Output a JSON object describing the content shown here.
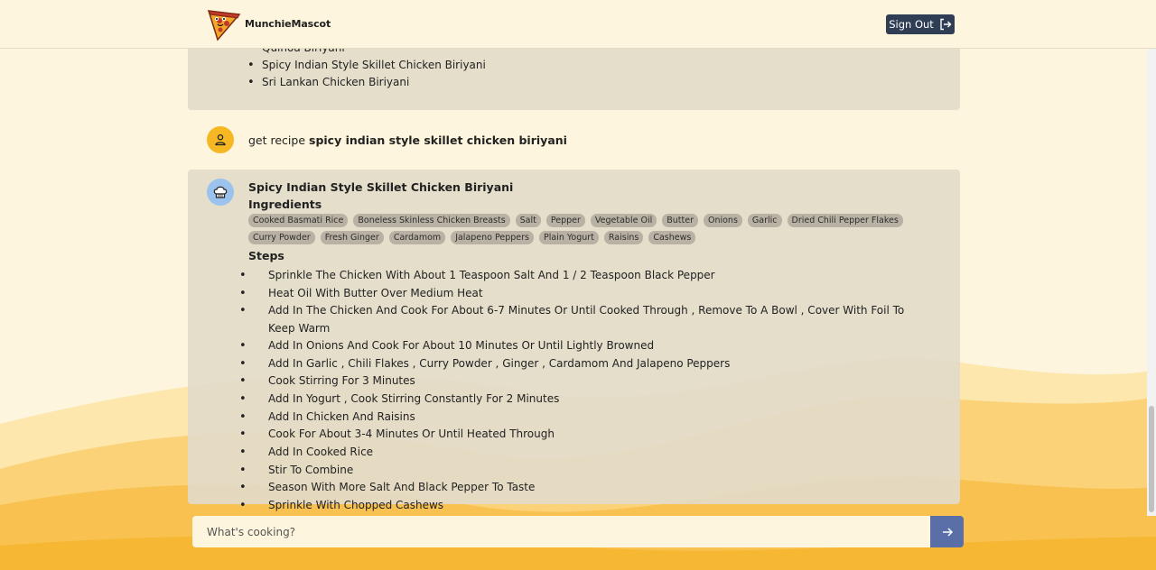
{
  "header": {
    "app_name": "MunchieMascot",
    "signout_label": "Sign Out"
  },
  "previous_results": {
    "items": [
      "Quinoa Biriyani",
      "Spicy Indian Style Skillet Chicken Biriyani",
      "Sri Lankan Chicken Biriyani"
    ]
  },
  "user_message": {
    "prefix": "get recipe ",
    "query": "spicy indian style skillet chicken biriyani"
  },
  "recipe": {
    "title": "Spicy Indian Style Skillet Chicken Biriyani",
    "ingredients_label": "Ingredients",
    "ingredients": [
      "Cooked Basmati Rice",
      "Boneless Skinless Chicken Breasts",
      "Salt",
      "Pepper",
      "Vegetable Oil",
      "Butter",
      "Onions",
      "Garlic",
      "Dried Chili Pepper Flakes",
      "Curry Powder",
      "Fresh Ginger",
      "Cardamom",
      "Jalapeno Peppers",
      "Plain Yogurt",
      "Raisins",
      "Cashews"
    ],
    "steps_label": "Steps",
    "steps": [
      "Sprinkle The Chicken With About 1 Teaspoon Salt And 1 / 2 Teaspoon Black Pepper",
      "Heat Oil With Butter Over Medium Heat",
      "Add In The Chicken And Cook For About 6-7 Minutes Or Until Cooked Through , Remove To A Bowl , Cover With Foil To Keep Warm",
      "Add In Onions And Cook For About 10 Minutes Or Until Lightly Browned",
      "Add In Garlic , Chili Flakes , Curry Powder , Ginger , Cardamom And Jalapeno Peppers",
      "Cook Stirring For 3 Minutes",
      "Add In Yogurt , Cook Stirring Constantly For 2 Minutes",
      "Add In Chicken And Raisins",
      "Cook For About 3-4 Minutes Or Until Heated Through",
      "Add In Cooked Rice",
      "Stir To Combine",
      "Season With More Salt And Black Pepper To Taste",
      "Sprinkle With Chopped Cashews"
    ]
  },
  "input": {
    "placeholder": "What's cooking?"
  },
  "icons": {
    "logo": "pizza-mascot-icon",
    "signout": "sign-out-icon",
    "user": "user-icon",
    "bot": "chef-hat-icon",
    "send": "arrow-right-icon"
  },
  "colors": {
    "background": "#fdf5dd",
    "accent_yellow": "#f5b823",
    "button_dark": "#2f3d55",
    "send_button": "#5a6fa8",
    "bot_avatar": "#9cc3ee"
  }
}
